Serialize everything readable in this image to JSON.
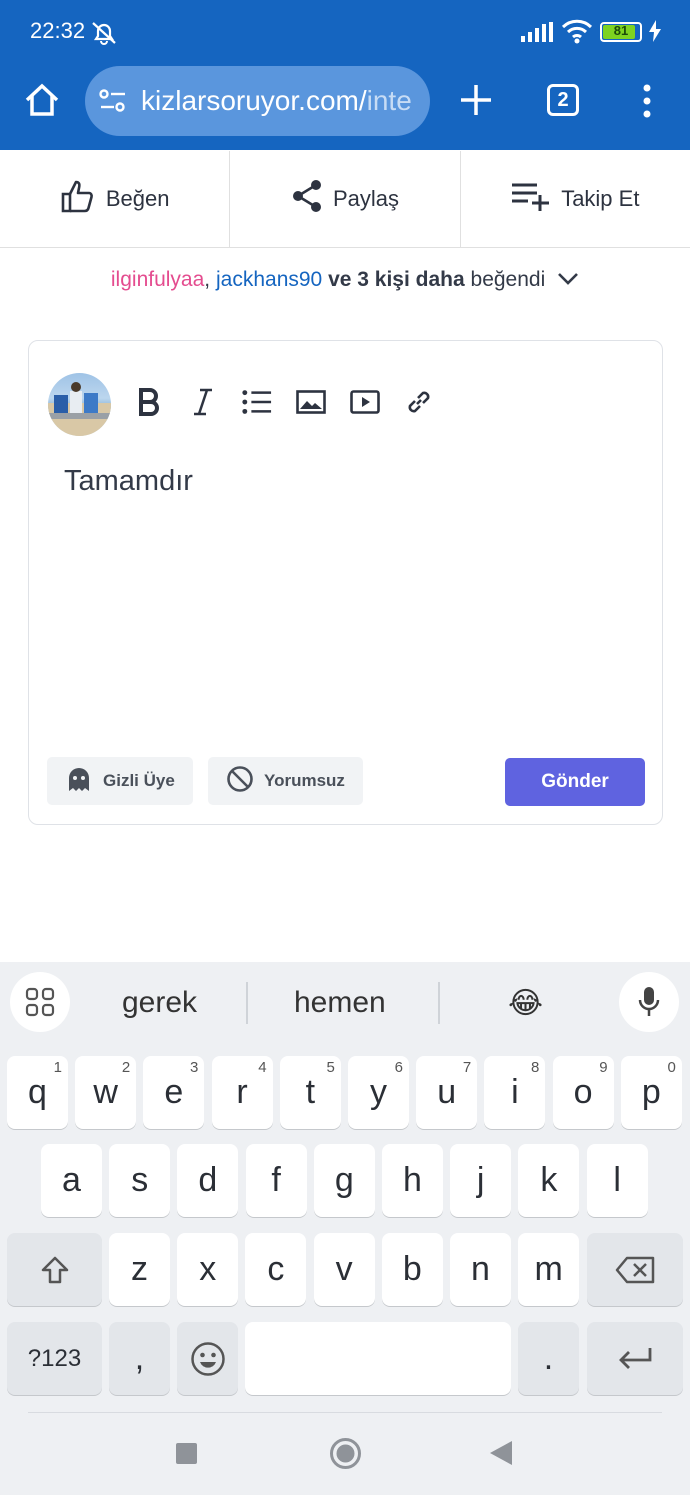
{
  "status": {
    "time": "22:32",
    "battery": "81"
  },
  "browser": {
    "url_main": "kizlarsoruyor.com/",
    "url_faded": "inte",
    "tab_count": "2"
  },
  "actions": {
    "like": "Beğen",
    "share": "Paylaş",
    "follow": "Takip Et"
  },
  "likes": {
    "user1": "ilginfulyaa",
    "comma": ",",
    "user2": "jackhans90",
    "and": "ve",
    "count": "3 kişi daha",
    "suffix": "beğendi"
  },
  "editor": {
    "text": "Tamamdır",
    "anonymous_label": "Gizli Üye",
    "no_comment_label": "Yorumsuz",
    "send_label": "Gönder"
  },
  "keyboard": {
    "suggestions": [
      "gerek",
      "hemen",
      "😂"
    ],
    "row1": [
      "q",
      "w",
      "e",
      "r",
      "t",
      "y",
      "u",
      "i",
      "o",
      "p"
    ],
    "row1_hints": [
      "1",
      "2",
      "3",
      "4",
      "5",
      "6",
      "7",
      "8",
      "9",
      "0"
    ],
    "row2": [
      "a",
      "s",
      "d",
      "f",
      "g",
      "h",
      "j",
      "k",
      "l"
    ],
    "row3": [
      "z",
      "x",
      "c",
      "v",
      "b",
      "n",
      "m"
    ],
    "symbols_label": "?123",
    "comma_key": ",",
    "period_key": "."
  }
}
